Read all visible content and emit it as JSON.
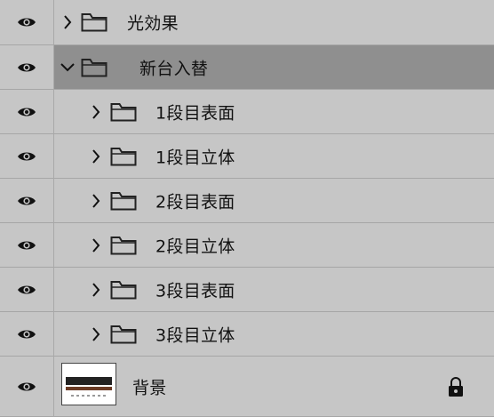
{
  "layers": [
    {
      "name": "光効果",
      "type": "group",
      "expanded": false,
      "level": 0
    },
    {
      "name": "新台入替",
      "type": "group",
      "expanded": true,
      "level": 0,
      "selected": true
    },
    {
      "name": "1段目表面",
      "type": "group",
      "expanded": false,
      "level": 1
    },
    {
      "name": "1段目立体",
      "type": "group",
      "expanded": false,
      "level": 1
    },
    {
      "name": "2段目表面",
      "type": "group",
      "expanded": false,
      "level": 1
    },
    {
      "name": "2段目立体",
      "type": "group",
      "expanded": false,
      "level": 1
    },
    {
      "name": "3段目表面",
      "type": "group",
      "expanded": false,
      "level": 1
    },
    {
      "name": "3段目立体",
      "type": "group",
      "expanded": false,
      "level": 1
    },
    {
      "name": "背景",
      "type": "image",
      "locked": true,
      "level": 0
    }
  ],
  "icons": {
    "visibility": "eye-icon",
    "collapsed": "chevron-right-icon",
    "expanded": "chevron-down-icon",
    "group": "folder-icon",
    "lock": "lock-icon"
  },
  "colors": {
    "panel": "#c6c6c6",
    "selected_row": "#8f8f8f"
  }
}
